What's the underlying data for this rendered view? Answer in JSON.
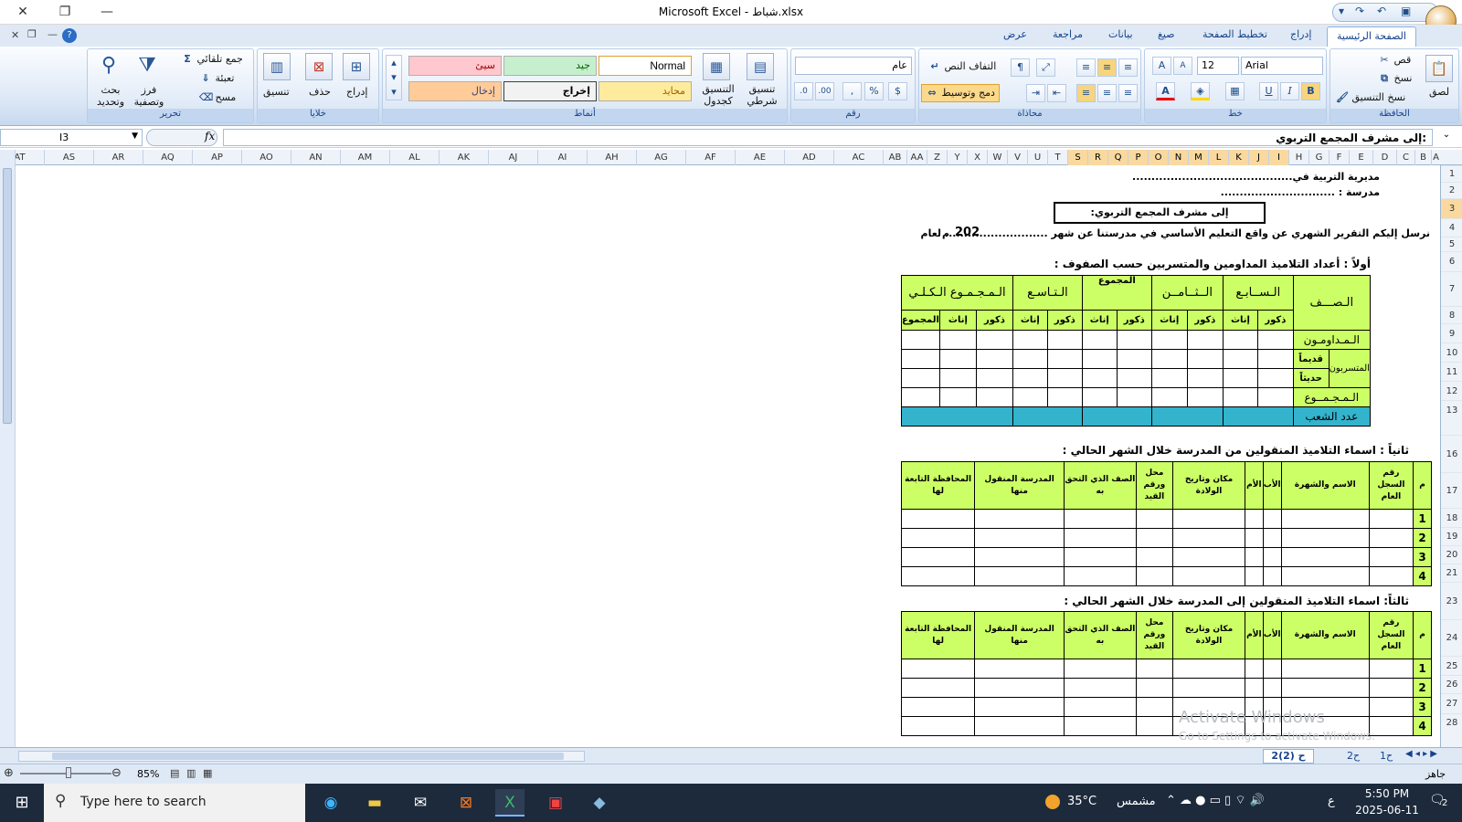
{
  "window": {
    "title": "Microsoft Excel - شباط.xlsx",
    "close": "✕",
    "maximize": "❐",
    "minimize": "—"
  },
  "tabs": [
    "الصفحة الرئيسية",
    "إدراج",
    "تخطيط الصفحة",
    "صيغ",
    "بيانات",
    "مراجعة",
    "عرض"
  ],
  "ribbon": {
    "clipboard": {
      "label": "الحافظة",
      "paste": "لصق",
      "cut": "قص",
      "copy": "نسخ",
      "format_painter": "نسخ التنسيق"
    },
    "font": {
      "label": "خط",
      "name": "Arial",
      "size": "12",
      "bold": "B",
      "italic": "I",
      "underline": "U"
    },
    "alignment": {
      "label": "محاذاة",
      "wrap": "التفاف النص",
      "merge": "دمج وتوسيط"
    },
    "number": {
      "label": "رقم",
      "format": "عام",
      "currency": "$",
      "percent": "%",
      "comma": ","
    },
    "styles": {
      "label": "أنماط",
      "cond_format": "تنسيق شرطي",
      "table_format": "التنسيق كجدول",
      "cells": [
        {
          "t": "Normal",
          "c": "#ffffff"
        },
        {
          "t": "جيد",
          "c": "#c6efce"
        },
        {
          "t": "سيئ",
          "c": "#ffc7ce"
        },
        {
          "t": "محايد",
          "c": "#ffeb9c"
        },
        {
          "t": "إخراج",
          "c": "#f2f2f2"
        },
        {
          "t": "إدخال",
          "c": "#ffcc99"
        }
      ]
    },
    "cells": {
      "label": "خلايا",
      "insert": "إدراج",
      "delete": "حذف",
      "format": "تنسيق"
    },
    "editing": {
      "label": "تحرير",
      "autosum": "جمع تلقائي",
      "fill": "تعبئة",
      "clear": "مسح",
      "sort": "فرز وتصفية",
      "find": "بحث وتحديد"
    }
  },
  "formula_bar": {
    "name_box": "I3",
    "fx": "fx",
    "content": "إلى مشرف المجمع التربوي:"
  },
  "columns": [
    "A",
    "B",
    "C",
    "D",
    "E",
    "F",
    "G",
    "H",
    "I",
    "J",
    "K",
    "L",
    "M",
    "N",
    "O",
    "P",
    "Q",
    "R",
    "S",
    "T",
    "U",
    "V",
    "W",
    "X",
    "Y",
    "Z",
    "AA",
    "AB",
    "AC",
    "AD",
    "AE",
    "AF",
    "AG",
    "AH",
    "AI",
    "AJ",
    "AK",
    "AL",
    "AM",
    "AN",
    "AO",
    "AP",
    "AQ",
    "AR",
    "AS",
    "AT"
  ],
  "rows": [
    "1",
    "2",
    "3",
    "4",
    "5",
    "6",
    "7",
    "8",
    "9",
    "10",
    "11",
    "12",
    "13",
    "16",
    "17",
    "18",
    "19",
    "20",
    "21",
    "23",
    "24",
    "25",
    "26",
    "27",
    "28"
  ],
  "sheet": {
    "line1": "مديرية التربية في..........................................",
    "line2": "مدرسة : ..............................",
    "addressee": "إلى مشرف المجمع التربوي:",
    "intro": "نرسل إليكم التقرير الشهري عن واقع التعليم الأساسي في مدرستنا عن شهر ........................... لعام",
    "year": "202",
    "m": "م",
    "sec1": "أولاً :  أعداد التلاميذ المداومين والمتسربين حسب الصفوف :",
    "t1": {
      "grade": "الـصـــف",
      "g7": "الـســابـع",
      "g8": "الــثــامــن",
      "total": "المجموع",
      "g9": "الـتـاسـع",
      "grand": "الـمـجـمـوع الـكـلـي",
      "male": "ذكور",
      "female": "إناث",
      "sum": "المجموع",
      "attending": "الـمـداومـون",
      "dropouts": "المتسربون",
      "old": "قديماً",
      "new": "حديثاً",
      "sumrow": "الـمـجـمــوع",
      "sections": "عدد الشعب"
    },
    "sec2": "ثانياً : اسماء التلاميذ المنقولين من المدرسة خلال الشهر الحالي :",
    "sec3": "ثالثاً:  اسماء التلاميذ المنقولين إلى المدرسة خلال الشهر الحالي :",
    "t2": {
      "m": "م",
      "reg": "رقم السجل العام",
      "name": "الاسم والشهرة",
      "father": "الأب",
      "mother": "الأم",
      "birth": "مكان وتاريخ الولادة",
      "record": "محل ورقم القيد",
      "grade": "الصف الذي التحق به",
      "school": "المدرسة المنقول منها",
      "gov": "المحافظة التابعة لها",
      "nums": [
        "1",
        "2",
        "3",
        "4"
      ]
    }
  },
  "sheet_tabs": [
    "2ح (2)",
    "2ح",
    "1ح"
  ],
  "status": {
    "ready": "جاهز",
    "zoom": "85%"
  },
  "watermark": {
    "l1": "Activate Windows",
    "l2": "Go to Settings to activate Windows."
  },
  "taskbar": {
    "search": "Type here to search",
    "weather": "35°C",
    "weather_label": "مشمس",
    "lang": "ع",
    "time": "5:50 PM",
    "date": "2025-06-11",
    "notif": "2"
  }
}
